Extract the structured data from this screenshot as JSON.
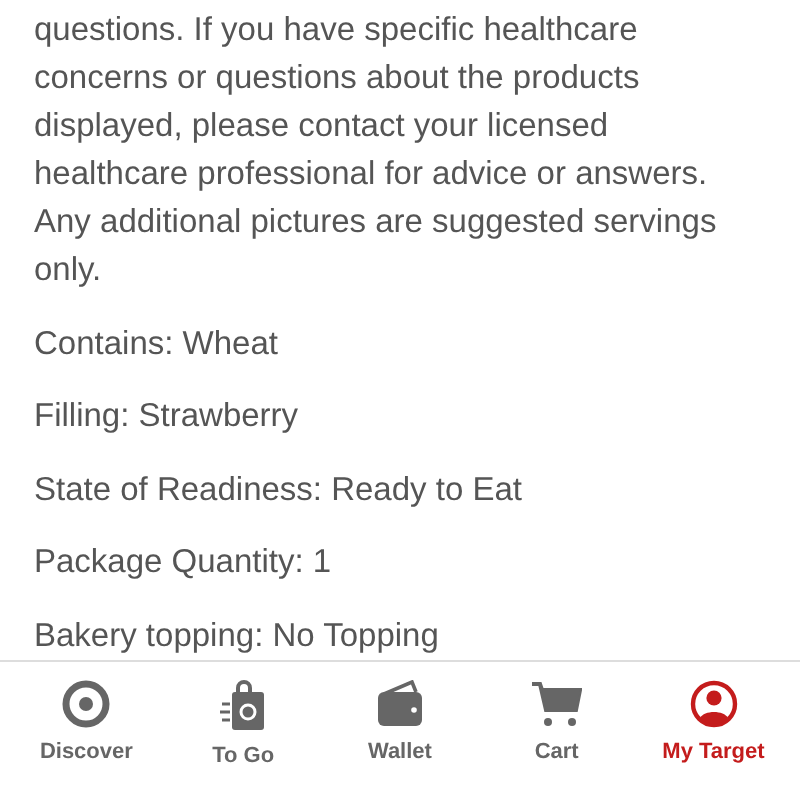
{
  "description": "questions. If you have specific healthcare concerns or questions about the products displayed, please contact your licensed healthcare professional for advice or answers. Any additional pictures are suggested servings only.",
  "details": [
    "Contains: Wheat",
    "Filling: Strawberry",
    "State of Readiness: Ready to Eat",
    "Package Quantity: 1",
    "Bakery topping: No Topping"
  ],
  "tab_bar": [
    {
      "label": "Discover",
      "kind": "target",
      "selected": false
    },
    {
      "label": "To Go",
      "kind": "bag",
      "selected": false
    },
    {
      "label": "Wallet",
      "kind": "wallet",
      "selected": false
    },
    {
      "label": "Cart",
      "kind": "cart",
      "selected": false
    },
    {
      "label": "My Target",
      "kind": "person",
      "selected": true
    }
  ]
}
